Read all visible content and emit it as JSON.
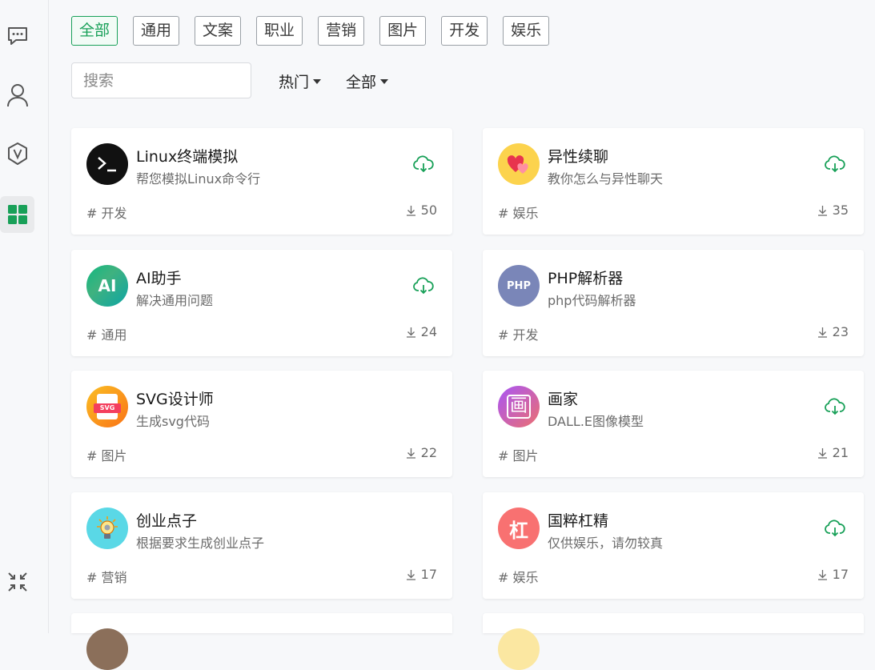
{
  "sidebar": {
    "items": [
      {
        "icon": "chat-icon"
      },
      {
        "icon": "user-icon"
      },
      {
        "icon": "vue-icon"
      },
      {
        "icon": "grid-icon",
        "active": true
      }
    ],
    "bottom_icon": "collapse-icon"
  },
  "tabs": [
    "全部",
    "通用",
    "文案",
    "职业",
    "营销",
    "图片",
    "开发",
    "娱乐"
  ],
  "active_tab": "全部",
  "search": {
    "placeholder": "搜索"
  },
  "filters": {
    "sort": "热门",
    "scope": "全部"
  },
  "cards": [
    {
      "title": "Linux终端模拟",
      "desc": "帮您模拟Linux命令行",
      "tag": "# 开发",
      "downloads": "50",
      "cloud": true,
      "avatar": "terminal-avatar"
    },
    {
      "title": "异性续聊",
      "desc": "教你怎么与异性聊天",
      "tag": "# 娱乐",
      "downloads": "35",
      "cloud": true,
      "avatar": "hearts-avatar"
    },
    {
      "title": "AI助手",
      "desc": "解决通用问题",
      "tag": "# 通用",
      "downloads": "24",
      "cloud": true,
      "avatar": "ai-avatar",
      "avatar_text": "AI"
    },
    {
      "title": "PHP解析器",
      "desc": "php代码解析器",
      "tag": "# 开发",
      "downloads": "23",
      "cloud": false,
      "avatar": "php-avatar",
      "avatar_text": "PHP"
    },
    {
      "title": "SVG设计师",
      "desc": "生成svg代码",
      "tag": "# 图片",
      "downloads": "22",
      "cloud": false,
      "avatar": "svg-avatar",
      "avatar_text": "SVG"
    },
    {
      "title": "画家",
      "desc": "DALL.E图像模型",
      "tag": "# 图片",
      "downloads": "21",
      "cloud": true,
      "avatar": "painter-avatar",
      "avatar_text": "画"
    },
    {
      "title": "创业点子",
      "desc": "根据要求生成创业点子",
      "tag": "# 营销",
      "downloads": "17",
      "cloud": false,
      "avatar": "idea-avatar"
    },
    {
      "title": "国粹杠精",
      "desc": "仅供娱乐，请勿较真",
      "tag": "# 娱乐",
      "downloads": "17",
      "cloud": true,
      "avatar": "debater-avatar",
      "avatar_text": "杠"
    }
  ],
  "colors": {
    "accent": "#18a058",
    "background": "#f7f8fa",
    "card": "#ffffff"
  }
}
